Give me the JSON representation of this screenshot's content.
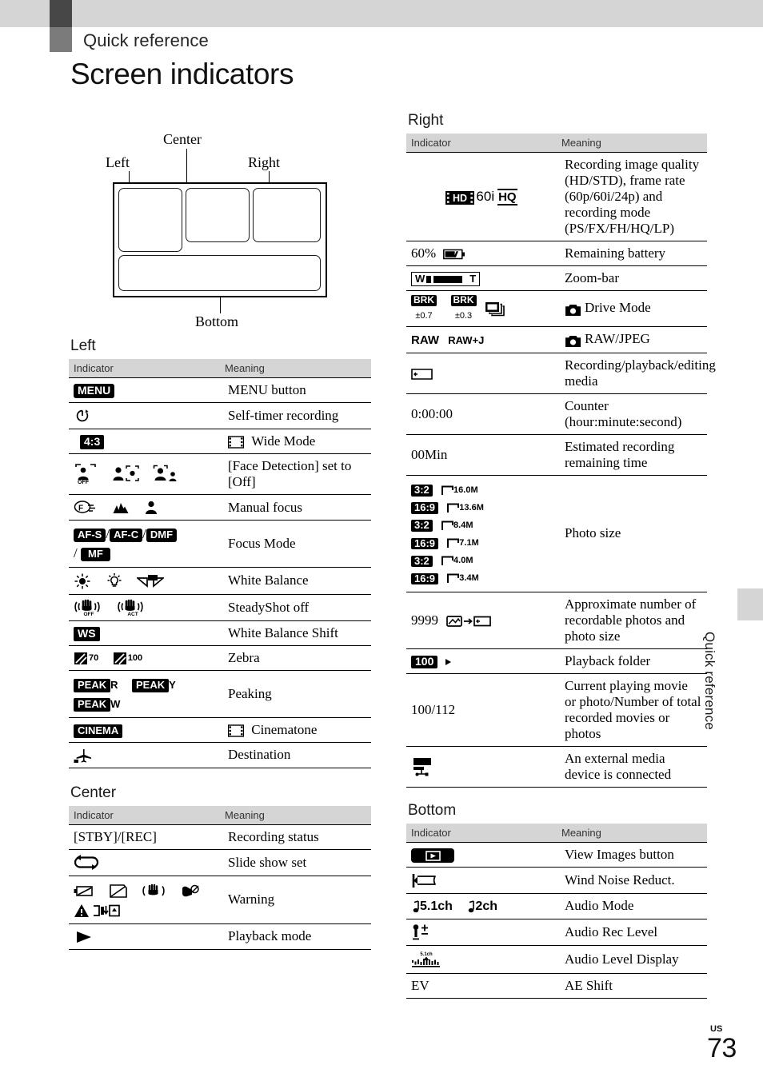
{
  "header": {
    "kicker": "Quick reference",
    "title": "Screen indicators"
  },
  "side_tab": {
    "label": "Quick reference"
  },
  "folio": {
    "region": "US",
    "page": "73"
  },
  "diagram": {
    "labels": {
      "left": "Left",
      "center": "Center",
      "right": "Right",
      "bottom": "Bottom"
    }
  },
  "columns": {
    "indicator_header": "Indicator",
    "meaning_header": "Meaning"
  },
  "left": {
    "heading": "Left",
    "rows": [
      {
        "indicator": "MENU",
        "meaning": "MENU button"
      },
      {
        "indicator": "self-timer-icon",
        "meaning": "Self-timer recording"
      },
      {
        "indicator": "4:3",
        "meaning": "Wide Mode"
      },
      {
        "indicator": "face-detection-icons",
        "meaning": "[Face Detection] set to [Off]"
      },
      {
        "indicator": "manual-focus-icons",
        "meaning": "Manual focus"
      },
      {
        "indicator": "AF-S / AF-C / DMF / MF",
        "meaning": "Focus Mode"
      },
      {
        "indicator": "white-balance-icons",
        "meaning": "White Balance"
      },
      {
        "indicator": "steadyshot-icons",
        "meaning": "SteadyShot off"
      },
      {
        "indicator": "WS",
        "meaning": "White Balance Shift"
      },
      {
        "indicator": "zebra-70 zebra-100",
        "meaning": "Zebra"
      },
      {
        "indicator": "PEAK R  PEAK Y  PEAK W",
        "meaning": "Peaking"
      },
      {
        "indicator": "CINEMA",
        "meaning": "Cinematone"
      },
      {
        "indicator": "destination-icon",
        "meaning": "Destination"
      }
    ],
    "focus_mode_parts": [
      "AF-S",
      "AF-C",
      "DMF",
      "MF"
    ],
    "zebra_values": [
      "70",
      "100"
    ],
    "peaking_values": [
      "R",
      "Y",
      "W"
    ],
    "peak_label": "PEAK",
    "cinema_label": "CINEMA",
    "ws_label": "WS",
    "menu_label": "MENU",
    "ratio_label": "4:3"
  },
  "center": {
    "heading": "Center",
    "rows": [
      {
        "indicator": "[STBY]/[REC]",
        "meaning": "Recording status"
      },
      {
        "indicator": "slide-show-loop-icon",
        "meaning": "Slide show set"
      },
      {
        "indicator": "warning-icons",
        "meaning": "Warning"
      },
      {
        "indicator": "play-triangle-icon",
        "meaning": "Playback mode"
      }
    ]
  },
  "right": {
    "heading": "Right",
    "rows": [
      {
        "indicator": "HD 60i HQ",
        "meaning": "Recording image quality (HD/STD), frame rate (60p/60i/24p) and recording mode (PS/FX/FH/HQ/LP)"
      },
      {
        "indicator": "60% battery-icon",
        "meaning": "Remaining battery"
      },
      {
        "indicator": "W ▮▬ T",
        "meaning": "Zoom-bar"
      },
      {
        "indicator": "BRK ±0.7  BRK ±0.3  burst-icon",
        "meaning": "Drive Mode"
      },
      {
        "indicator": "RAW  RAW+J",
        "meaning": "RAW/JPEG"
      },
      {
        "indicator": "media-card-icon",
        "meaning": "Recording/playback/editing media"
      },
      {
        "indicator": "0:00:00",
        "meaning": "Counter (hour:minute:second)"
      },
      {
        "indicator": "00Min",
        "meaning": "Estimated recording remaining time"
      },
      {
        "indicator": "photo-size-icons",
        "meaning": "Photo size"
      },
      {
        "indicator": "9999 photo→media",
        "meaning": "Approximate number of recordable photos and photo size"
      },
      {
        "indicator": "100 folder-icon",
        "meaning": "Playback folder"
      },
      {
        "indicator": "100/112",
        "meaning": "Current playing movie or photo/Number of total recorded movies or photos"
      },
      {
        "indicator": "external-media-usb-icon",
        "meaning": "An external media device is connected"
      }
    ],
    "hd_badge": "HD",
    "frame_rate": "60i",
    "rec_mode": "HQ",
    "battery_percent": "60%",
    "zoom_w": "W",
    "zoom_t": "T",
    "brk_label": "BRK",
    "brk_values": [
      "±0.7",
      "±0.3"
    ],
    "raw_label": "RAW",
    "rawj_label": "RAW+J",
    "counter": "0:00:00",
    "remaining": "00Min",
    "photo_sizes": [
      {
        "ratio": "3:2",
        "size": "16.0M"
      },
      {
        "ratio": "16:9",
        "size": "13.6M"
      },
      {
        "ratio": "3:2",
        "size": "8.4M"
      },
      {
        "ratio": "16:9",
        "size": "7.1M"
      },
      {
        "ratio": "3:2",
        "size": "4.0M"
      },
      {
        "ratio": "16:9",
        "size": "3.4M"
      }
    ],
    "recordable_count": "9999",
    "folder_number": "100",
    "playback_position": "100/112",
    "drive_mode_label": "Drive Mode",
    "raw_jpeg_label": "RAW/JPEG"
  },
  "bottom": {
    "heading": "Bottom",
    "rows": [
      {
        "indicator": "view-images-button-icon",
        "meaning": "View Images button"
      },
      {
        "indicator": "wind-noise-flag-icon",
        "meaning": "Wind Noise Reduct."
      },
      {
        "indicator": "♪5.1ch ♪2ch",
        "meaning": "Audio Mode"
      },
      {
        "indicator": "audio-rec-level-icon",
        "meaning": "Audio Rec Level"
      },
      {
        "indicator": "audio-level-display-icon",
        "meaning": "Audio Level Display"
      },
      {
        "indicator": "EV",
        "meaning": "AE Shift"
      }
    ],
    "audio_51": "5.1ch",
    "audio_2": "2ch",
    "ev_label": "EV"
  }
}
